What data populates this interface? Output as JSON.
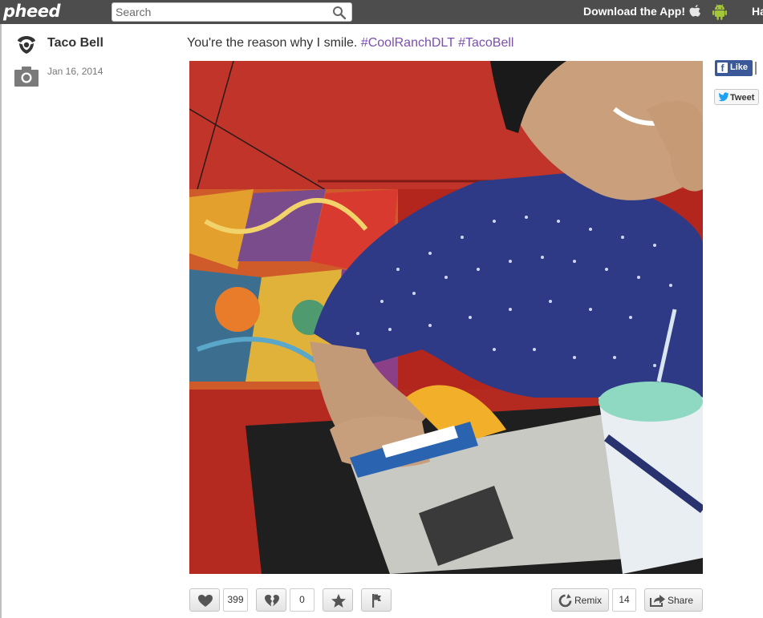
{
  "topbar": {
    "logo": "pheed",
    "search_placeholder": "Search",
    "download": "Download the App!",
    "nav_truncated": "Ha"
  },
  "post": {
    "author": "Taco Bell",
    "date": "Jan 16, 2014",
    "caption_text": "You're the reason why I smile.",
    "hashtags": [
      "#CoolRanchDLT",
      "#TacoBell"
    ]
  },
  "social": {
    "like_label": "Like",
    "tweet_label": "Tweet"
  },
  "actions": {
    "likes": "399",
    "dislikes": "0",
    "remix_label": "Remix",
    "remix_count": "14",
    "share_label": "Share"
  },
  "colors": {
    "topbar": "#4d4d4d",
    "hashtag": "#7b4fae",
    "facebook": "#3b5998",
    "twitter": "#1da1f2"
  }
}
